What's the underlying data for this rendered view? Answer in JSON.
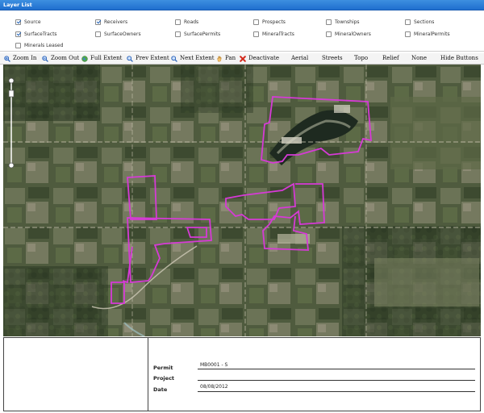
{
  "layer_list": {
    "title": "Layer List",
    "layers": [
      {
        "label": "Source",
        "checked": true
      },
      {
        "label": "Receivers",
        "checked": true
      },
      {
        "label": "Roads",
        "checked": false
      },
      {
        "label": "Prospects",
        "checked": false
      },
      {
        "label": "Townships",
        "checked": false
      },
      {
        "label": "Sections",
        "checked": false
      },
      {
        "label": "SurfaceTracts",
        "checked": true
      },
      {
        "label": "SurfaceOwners",
        "checked": false
      },
      {
        "label": "SurfacePermits",
        "checked": false
      },
      {
        "label": "MineralTracts",
        "checked": false
      },
      {
        "label": "MineralOwners",
        "checked": false
      },
      {
        "label": "MineralPermits",
        "checked": false
      },
      {
        "label": "Minerals Leased",
        "checked": false
      }
    ]
  },
  "toolbar": {
    "zoom_in": "Zoom In",
    "zoom_out": "Zoom Out",
    "full_extent": "Full Extent",
    "prev_extent": "Prev Extent",
    "next_extent": "Next Extent",
    "pan": "Pan",
    "deactivate": "Deactivate",
    "aerial": "Aerial",
    "streets": "Streets",
    "topo": "Topo",
    "relief": "Relief",
    "none": "None",
    "hide_buttons": "Hide Buttons"
  },
  "map": {
    "basemap": "Aerial",
    "tract_outline_color": "#d63ad6"
  },
  "info_panel": {
    "permit_label": "Permit",
    "permit_value": "MB0001 - S",
    "project_label": "Project",
    "project_value": "",
    "date_label": "Date",
    "date_value": "08/08/2012"
  }
}
